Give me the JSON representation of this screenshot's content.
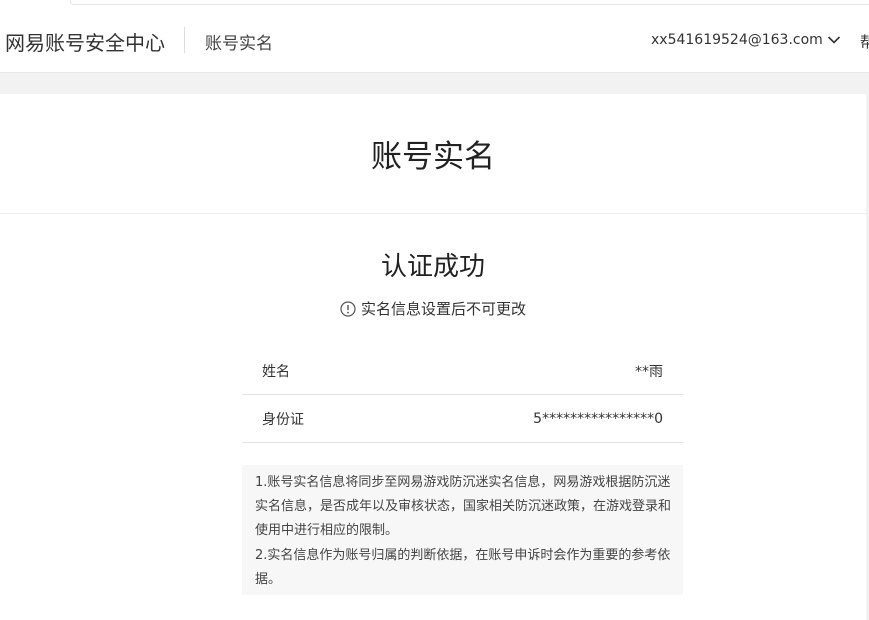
{
  "header": {
    "brand": "网易账号安全中心",
    "subtitle": "账号实名",
    "account_email": "xx541619524@163.com",
    "help_label": "帮"
  },
  "main": {
    "page_title": "账号实名",
    "status_title": "认证成功",
    "notice_icon": "info-circle-icon",
    "notice_text": "实名信息设置后不可更改",
    "fields": [
      {
        "label": "姓名",
        "value": "**雨"
      },
      {
        "label": "身份证",
        "value": "5****************0"
      }
    ],
    "notes": [
      "1.账号实名信息将同步至网易游戏防沉迷实名信息，网易游戏根据防沉迷实名信息，是否成年以及审核状态，国家相关防沉迷政策，在游戏登录和使用中进行相应的限制。",
      "2.实名信息作为账号归属的判断依据，在账号申诉时会作为重要的参考依据。"
    ]
  }
}
